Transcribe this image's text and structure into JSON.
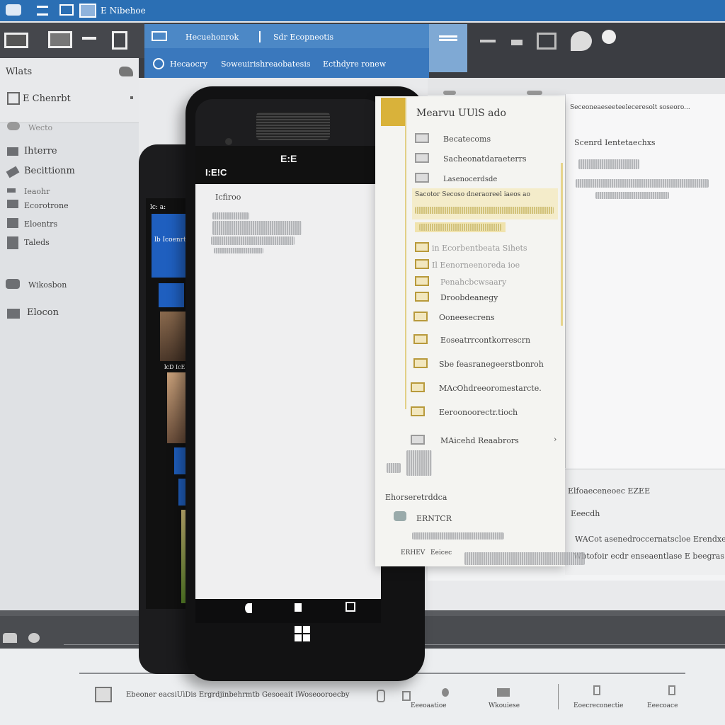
{
  "titlebar": {
    "title": "E Nibehoe"
  },
  "tabs": {
    "tab_active": "Hecuehonrok",
    "tab_second": "Sdr Ecopneotis",
    "sub_1": "Hecaocry",
    "sub_2": "Soweuirishreaobatesis",
    "sub_3": "Ecthdyre ronew"
  },
  "sidebar": {
    "header": "Wlats",
    "items": [
      {
        "label": "E Chenrbt"
      },
      {
        "label": "Wecto"
      },
      {
        "label": "Ihterre"
      },
      {
        "label": "Becittionm"
      },
      {
        "label": "Ieaohr"
      },
      {
        "label": "Ecorotrone"
      },
      {
        "label": "Eloentrs"
      },
      {
        "label": "Taleds"
      },
      {
        "label": "Wikosbon"
      },
      {
        "label": "Elocon"
      }
    ]
  },
  "phone": {
    "title": "I:E!C",
    "time": "E:E",
    "heading": "Icfiroo",
    "tile_label": "lb Icoenrt",
    "tile_small": "lc: a:",
    "tile_small_2": "lcD IcEoiEb"
  },
  "menu": {
    "title": "Mearvu UUlS ado",
    "items": [
      {
        "label": "Becatecoms"
      },
      {
        "label": "Sacheonatdaraeterrs"
      },
      {
        "label": "Lasenocerdsde"
      },
      {
        "label": "Sacotor Secoso dneraoreel iaeos ao"
      },
      {
        "label": "in Ecorbentbeata Sihets"
      },
      {
        "label": "Il Eenorneenoreda ioe"
      },
      {
        "label": "Penahcbcwsaary"
      },
      {
        "label": "Droobdeanegy"
      },
      {
        "label": "Ooneesecrens"
      },
      {
        "label": "Eoseatrrcontkorrescrn"
      },
      {
        "label": "Sbe feasranegeerstbonroh"
      },
      {
        "label": "MAcOhdreeoromestarcte."
      },
      {
        "label": "Eeroonoorectr.tioch"
      },
      {
        "label": "MAicehd Reaabrors"
      }
    ],
    "section": "Ehorseretrddca",
    "subitem": "ERNTCR",
    "footer_1": "ERHEV",
    "footer_2": "Eeicec"
  },
  "content": {
    "header": "Seceoneaeseeteeleceresolt soseoro...",
    "sub": "Scenrd Ientetaechxs",
    "footer_title": "Elfoaeceneoec EZEE",
    "footer_sub": "Eeecdh",
    "footer_line_1": "WACot asenedroccernatscloe Erendxer",
    "footer_line_2": "Wbtofoir ecdr enseaentlase E beegras."
  },
  "bottom": {
    "footer_text": "Ebeoner eacsiUìDis Ergrdjinbehrmtb Gesoeait iWoseooroecby",
    "btn_1": "Eeeoaatioe",
    "btn_2": "Wkouiese",
    "btn_3": "Eoecreconectie",
    "btn_4": "Eeecoace"
  }
}
